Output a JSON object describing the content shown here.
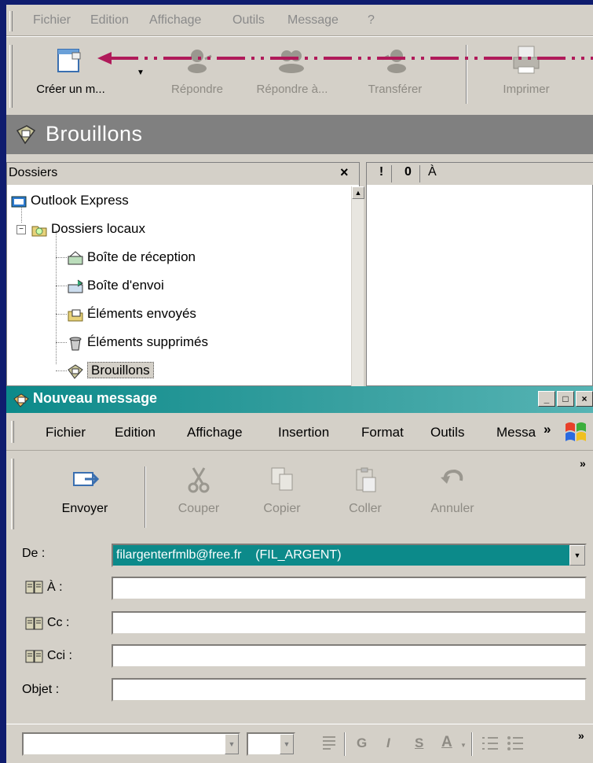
{
  "main_window": {
    "menu": [
      "Fichier",
      "Edition",
      "Affichage",
      "Outils",
      "Message",
      "?"
    ],
    "toolbar": [
      {
        "label": "Créer un m...",
        "icon": "new-message-icon",
        "enabled": true
      },
      {
        "label": "Répondre",
        "icon": "reply-icon",
        "enabled": false
      },
      {
        "label": "Répondre à...",
        "icon": "reply-all-icon",
        "enabled": false
      },
      {
        "label": "Transférer",
        "icon": "forward-icon",
        "enabled": false
      },
      {
        "label": "Imprimer",
        "icon": "print-icon",
        "enabled": false
      }
    ],
    "folder_title": "Brouillons",
    "folders_pane": {
      "header": "Dossiers",
      "close": "×",
      "root": "Outlook Express",
      "local": "Dossiers locaux",
      "items": [
        "Boîte de réception",
        "Boîte d'envoi",
        "Éléments envoyés",
        "Éléments supprimés",
        "Brouillons"
      ],
      "selected": "Brouillons"
    },
    "message_list": {
      "columns": [
        "!",
        "0",
        "À"
      ]
    }
  },
  "new_message": {
    "title": "Nouveau message",
    "window_buttons": [
      "_",
      "□",
      "×"
    ],
    "menu": [
      "Fichier",
      "Edition",
      "Affichage",
      "Insertion",
      "Format",
      "Outils",
      "Messa",
      "»"
    ],
    "toolbar": [
      {
        "label": "Envoyer",
        "icon": "send-icon",
        "enabled": true
      },
      {
        "label": "Couper",
        "icon": "cut-icon",
        "enabled": false
      },
      {
        "label": "Copier",
        "icon": "copy-icon",
        "enabled": false
      },
      {
        "label": "Coller",
        "icon": "paste-icon",
        "enabled": false
      },
      {
        "label": "Annuler",
        "icon": "undo-icon",
        "enabled": false
      }
    ],
    "toolbar_more": "»",
    "fields": {
      "from_label": "De :",
      "from_value": "filargenterfmlb@free.fr    (FIL_ARGENT)",
      "to_label": "À :",
      "cc_label": "Cc :",
      "bcc_label": "Cci :",
      "subject_label": "Objet :"
    },
    "format_bar": {
      "bold": "G",
      "italic": "I",
      "underline": "S",
      "font_color": "A",
      "more": "»"
    }
  },
  "colors": {
    "background": "#0f1c6e",
    "chrome": "#d4d0c8",
    "title_bar_gray": "#808080",
    "active_title": "#0c8a8a",
    "selection": "#0c8a8a",
    "arrow": "#b01a5a"
  }
}
